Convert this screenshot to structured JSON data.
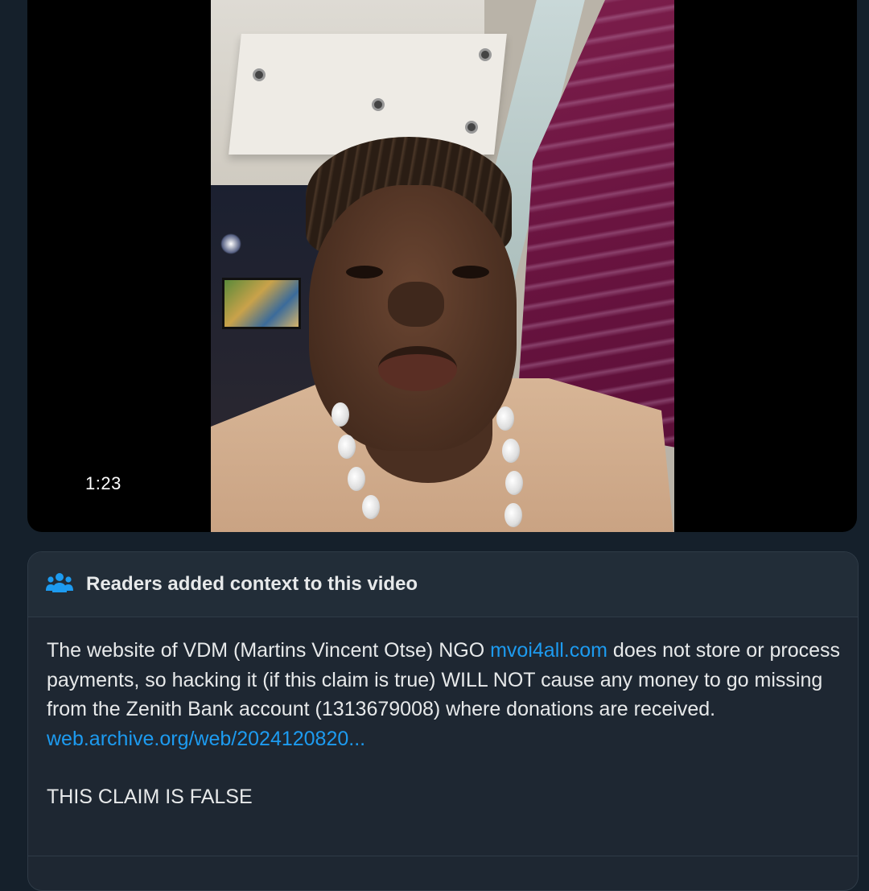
{
  "video": {
    "duration": "1:23"
  },
  "community_note": {
    "title": "Readers added context to this video",
    "icon": "people-icon",
    "body_before_link": "The website of VDM (Martins Vincent Otse) NGO ",
    "body_link": "mvoi4all.com",
    "body_after_link": " does not store or process payments, so hacking it (if this claim is true) WILL NOT cause any money to go missing from the Zenith Bank account (1313679008) where donations are received.",
    "source_link": "web.archive.org/web/2024120820...",
    "verdict": "THIS CLAIM IS FALSE"
  },
  "colors": {
    "background": "#15202b",
    "card": "#1e2732",
    "link": "#1d9bf0",
    "text": "#e7e9ea"
  }
}
